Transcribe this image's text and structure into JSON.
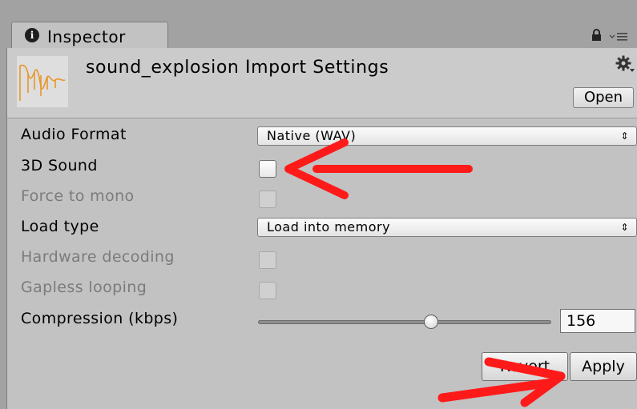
{
  "tab": {
    "icon": "info-icon",
    "icon_glyph": "i",
    "label": "Inspector"
  },
  "tab_strip_icons": [
    "lock-icon",
    "panel-menu-icon"
  ],
  "header": {
    "asset_icon": "audio-file-icon",
    "title": "sound_explosion Import Settings",
    "gear_icon": "gear-icon",
    "open_label": "Open"
  },
  "settings": {
    "audio_format": {
      "label": "Audio Format",
      "value": "Native (WAV)"
    },
    "sound_3d": {
      "label": "3D Sound",
      "checked": false
    },
    "force_mono": {
      "label": "Force to mono",
      "checked": false,
      "disabled": true
    },
    "load_type": {
      "label": "Load type",
      "value": "Load into memory"
    },
    "hardware_decoding": {
      "label": "Hardware decoding",
      "checked": false,
      "disabled": true
    },
    "gapless_looping": {
      "label": "Gapless looping",
      "checked": false,
      "disabled": true
    },
    "compression": {
      "label": "Compression (kbps)",
      "value": "156"
    }
  },
  "footer": {
    "revert_label": "Revert",
    "apply_label": "Apply"
  },
  "dropdown_arrow": "⇕",
  "colors": {
    "annotation_arrow": "#ff1a1a",
    "panel_bg": "#c2c2c2"
  }
}
